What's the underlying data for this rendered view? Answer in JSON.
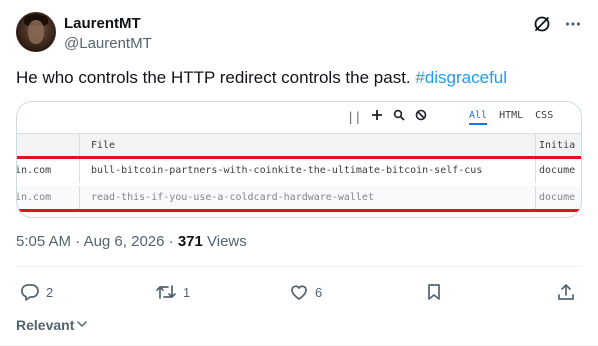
{
  "author": {
    "display_name": "LaurentMT",
    "handle": "@LaurentMT"
  },
  "tweet": {
    "text": "He who controls the HTTP redirect controls the past.",
    "hashtag": "#disgraceful"
  },
  "devtools": {
    "toolbar": {
      "separator": "||",
      "tabs": [
        "All",
        "HTML",
        "CSS"
      ],
      "active_tab": "All"
    },
    "columns": {
      "file": "File",
      "initiator": "Initia"
    },
    "rows": [
      {
        "domain": "in.com",
        "file": "bull-bitcoin-partners-with-coinkite-the-ultimate-bitcoin-self-cus",
        "initiator": "docume"
      },
      {
        "domain": "in.com",
        "file": "read-this-if-you-use-a-coldcard-hardware-wallet",
        "initiator": "docume"
      }
    ],
    "highlight_color": "#e3101f"
  },
  "meta": {
    "time": "5:05 AM",
    "separator": "·",
    "date": "Aug 6, 2026",
    "views_count": "371",
    "views_label": "Views"
  },
  "actions": {
    "replies": "2",
    "reposts": "1",
    "likes": "6"
  },
  "footer": {
    "sort_label": "Relevant"
  },
  "colors": {
    "accent": "#1d9bf0",
    "secondary_text": "#536471"
  },
  "icons": [
    "grok-icon",
    "more-icon",
    "add-icon",
    "search-icon",
    "block-icon",
    "reply-icon",
    "repost-icon",
    "like-icon",
    "bookmark-icon",
    "share-icon",
    "chevron-down-icon"
  ]
}
